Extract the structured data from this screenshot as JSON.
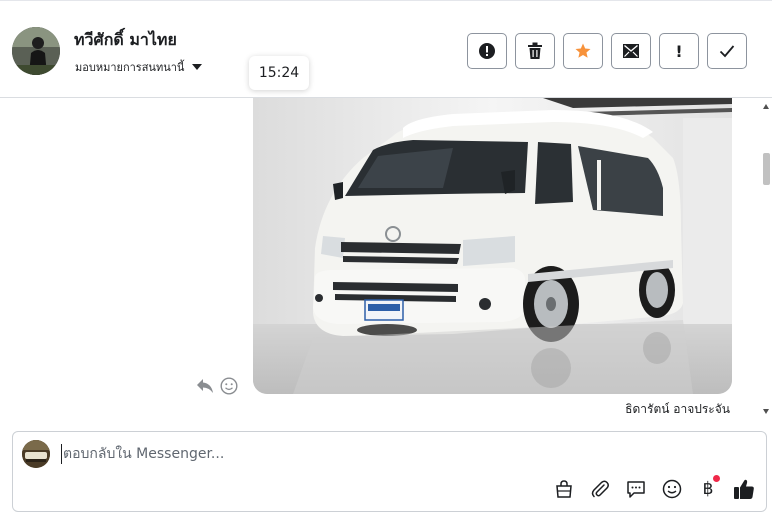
{
  "header": {
    "contact_name": "ทวีศักดิ์ มาไทย",
    "assign_label": "มอบหมายการสนทนานี้",
    "time_tooltip": "15:24",
    "actions": [
      {
        "name": "mark-spam-button",
        "icon": "alert-circle-icon"
      },
      {
        "name": "delete-button",
        "icon": "trash-icon"
      },
      {
        "name": "star-button",
        "icon": "star-icon",
        "color": "#f7923b"
      },
      {
        "name": "mark-unread-button",
        "icon": "envelope-icon"
      },
      {
        "name": "follow-up-button",
        "icon": "exclamation-icon",
        "label": "!"
      },
      {
        "name": "mark-done-button",
        "icon": "check-icon"
      }
    ]
  },
  "chat": {
    "image_message": {
      "icon": "van-photo"
    },
    "sender_name": "ธิดารัตน์ อาจประจัน",
    "message_tools": [
      {
        "name": "reply-icon"
      },
      {
        "name": "react-smiley-icon"
      }
    ]
  },
  "composer": {
    "placeholder": "ตอบกลับใน Messenger...",
    "value": "",
    "tools": [
      {
        "name": "shop-bag-icon"
      },
      {
        "name": "attachment-icon"
      },
      {
        "name": "saved-replies-icon"
      },
      {
        "name": "emoji-icon"
      },
      {
        "name": "payment-icon",
        "label": "฿"
      },
      {
        "name": "thumbs-up-icon"
      }
    ]
  },
  "colors": {
    "accent_star": "#f7923b",
    "notification_dot": "#f02849",
    "border": "#8d949e"
  }
}
